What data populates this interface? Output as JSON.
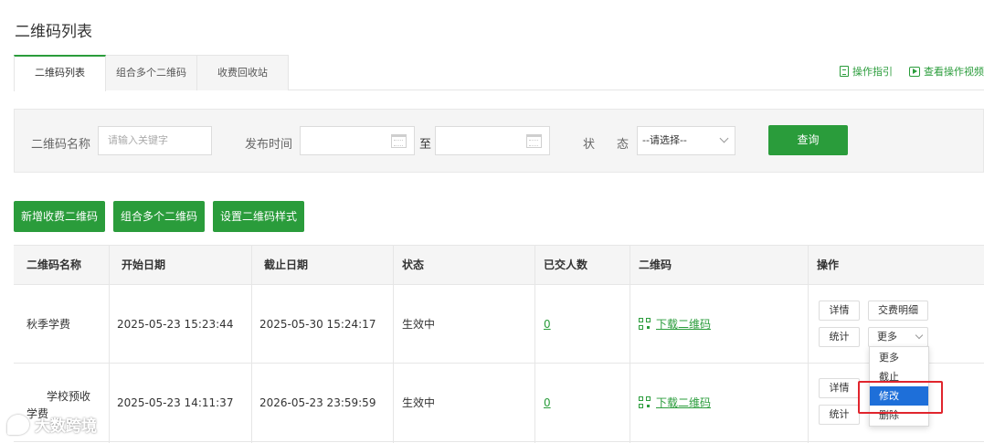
{
  "page": {
    "title": "二维码列表"
  },
  "tabs": [
    {
      "label": "二维码列表",
      "active": true
    },
    {
      "label": "组合多个二维码",
      "active": false
    },
    {
      "label": "收费回收站",
      "active": false
    }
  ],
  "tab_links": [
    {
      "label": "操作指引",
      "icon": "document-icon"
    },
    {
      "label": "查看操作视频",
      "icon": "video-icon"
    }
  ],
  "filter": {
    "name_label": "二维码名称",
    "name_placeholder": "请输入关键字",
    "publish_label": "发布时间",
    "to_label": "至",
    "status_label_1": "状",
    "status_label_2": "态",
    "status_value": "--请选择--",
    "query_button": "查询"
  },
  "actions": {
    "add": "新增收费二维码",
    "combine": "组合多个二维码",
    "style": "设置二维码样式"
  },
  "table": {
    "headers": [
      "二维码名称",
      "开始日期",
      "截止日期",
      "状态",
      "已交人数",
      "二维码",
      "操作"
    ],
    "rows": [
      {
        "name": "秋季学费",
        "start": "2025-05-23 15:23:44",
        "end": "2025-05-30 15:24:17",
        "status": "生效中",
        "count": "0",
        "qr": "下载二维码"
      },
      {
        "name_line1": "学校预收",
        "name_line2": "学费",
        "start": "2025-05-23 14:11:37",
        "end": "2026-05-23 23:59:59",
        "status": "生效中",
        "count": "0",
        "qr": "下载二维码"
      }
    ],
    "ops": {
      "detail": "详情",
      "bill": "交费明细",
      "stats": "统计",
      "more": "更多"
    }
  },
  "dropdown": {
    "items": [
      "更多",
      "截止",
      "修改",
      "删除"
    ],
    "selected_index": 2
  },
  "watermark": {
    "text": "大数跨境"
  },
  "colors": {
    "accent": "#2a9c3b",
    "highlight": "#e0252d",
    "selected": "#1e6fd9"
  }
}
